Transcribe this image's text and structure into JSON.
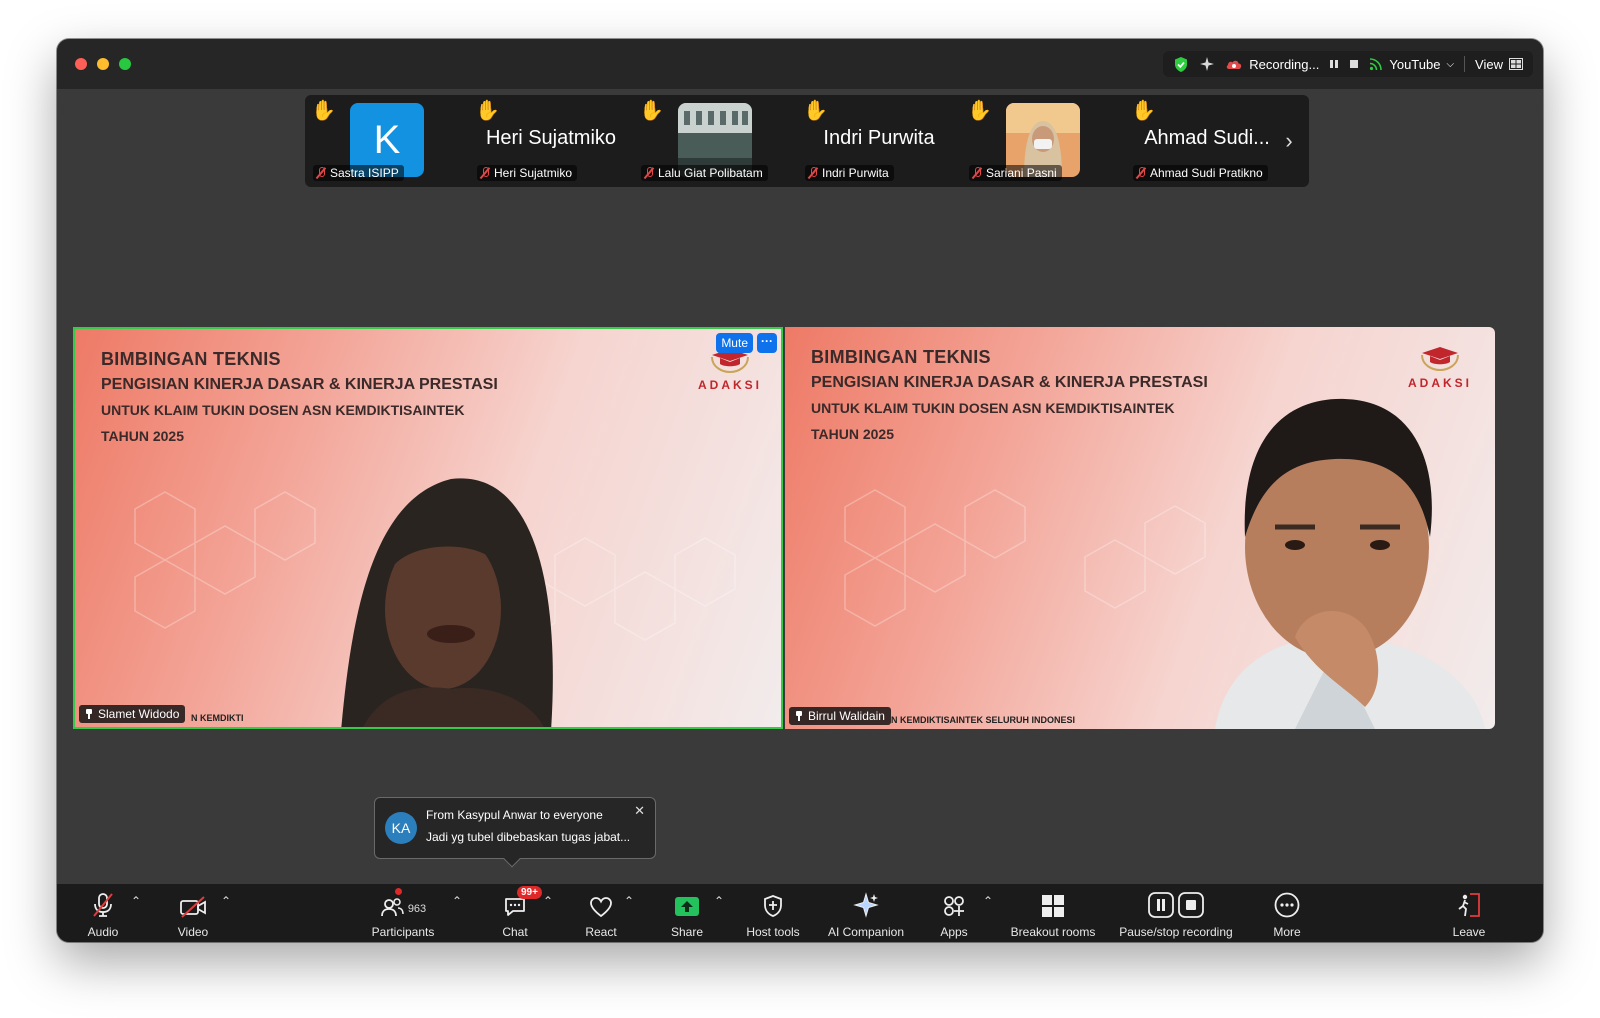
{
  "titlebar": {
    "recording_label": "Recording...",
    "stream_label": "YouTube",
    "view_label": "View"
  },
  "strip": {
    "tiles": [
      {
        "big_name": "",
        "avatar_letter": "K",
        "label": "Sastra ISIPP"
      },
      {
        "big_name": "Heri Sujatmiko",
        "label": "Heri Sujatmiko"
      },
      {
        "big_name": "",
        "label": "Lalu Giat Polibatam"
      },
      {
        "big_name": "Indri Purwita",
        "label": "Indri Purwita"
      },
      {
        "big_name": "",
        "label": "Sariani Pasni"
      },
      {
        "big_name": "Ahmad Sudi...",
        "label": "Ahmad Sudi Pratikno"
      }
    ],
    "next_icon": "chevron-right-icon"
  },
  "slide": {
    "title": "BIMBINGAN TEKNIS",
    "subtitle": "PENGISIAN KINERJA DASAR & KINERJA PRESTASI",
    "line3": "UNTUK KLAIM TUKIN DOSEN ASN KEMDIKTISAINTEK",
    "year": "TAHUN 2025",
    "logo_text": "ADAKSI"
  },
  "videos": {
    "left": {
      "name": "Slamet Widodo",
      "ticker": "N KEMDIKTI",
      "mute_label": "Mute",
      "more_label": "···"
    },
    "right": {
      "name": "Birrul Walidain",
      "ticker": "N KEMDIKTISAINTEK SELURUH INDONESI"
    }
  },
  "toast": {
    "avatar": "KA",
    "header": "From Kasypul Anwar to everyone",
    "message": "Jadi yg tubel dibebaskan tugas jabat...",
    "close": "✕"
  },
  "toolbar": {
    "audio": "Audio",
    "video": "Video",
    "participants": "Participants",
    "participants_count": "963",
    "chat": "Chat",
    "chat_badge": "99+",
    "react": "React",
    "share": "Share",
    "host_tools": "Host tools",
    "ai_companion": "AI Companion",
    "apps": "Apps",
    "breakout_rooms": "Breakout rooms",
    "pause_stop_recording": "Pause/stop recording",
    "more": "More",
    "leave": "Leave"
  },
  "colors": {
    "active_speaker": "#37c94a",
    "share_green": "#23c25c",
    "accent_blue": "#0e72ed",
    "badge_red": "#e02828"
  }
}
